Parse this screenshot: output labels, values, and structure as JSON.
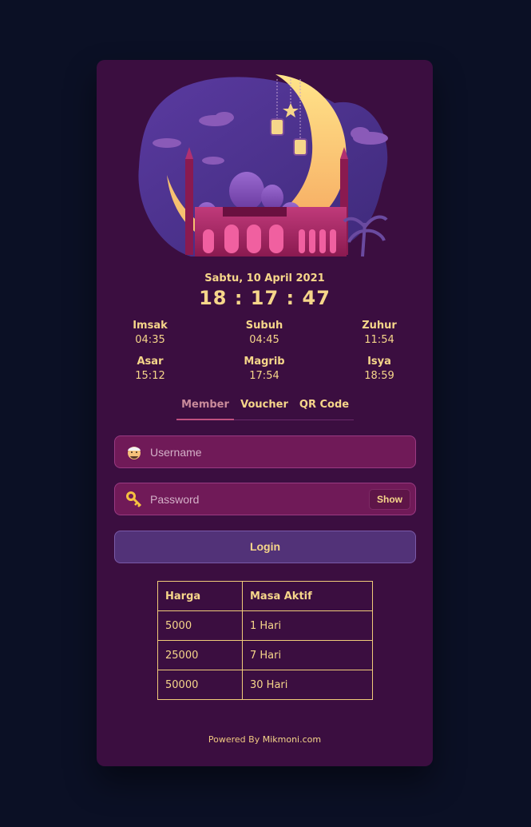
{
  "date": "Sabtu, 10 April 2021",
  "clock": "18 : 17 : 47",
  "prayers": [
    {
      "name": "Imsak",
      "time": "04:35"
    },
    {
      "name": "Subuh",
      "time": "04:45"
    },
    {
      "name": "Zuhur",
      "time": "11:54"
    },
    {
      "name": "Asar",
      "time": "15:12"
    },
    {
      "name": "Magrib",
      "time": "17:54"
    },
    {
      "name": "Isya",
      "time": "18:59"
    }
  ],
  "tabs": [
    "Member",
    "Voucher",
    "QR Code"
  ],
  "active_tab": "Member",
  "username": {
    "placeholder": "Username",
    "icon": "user-avatar-icon"
  },
  "password": {
    "placeholder": "Password",
    "icon": "key-icon",
    "show_label": "Show"
  },
  "login_label": "Login",
  "price_table": {
    "headers": [
      "Harga",
      "Masa Aktif"
    ],
    "rows": [
      [
        "5000",
        "1 Hari"
      ],
      [
        "25000",
        "7 Hari"
      ],
      [
        "50000",
        "30 Hari"
      ]
    ]
  },
  "footer": {
    "prefix": "Powered By",
    "brand": "Mikmoni.com"
  },
  "colors": {
    "background": "#0b1025",
    "card": "#3b0e40",
    "accent": "#f6d68a",
    "field": "#701a58",
    "button": "#523278"
  }
}
